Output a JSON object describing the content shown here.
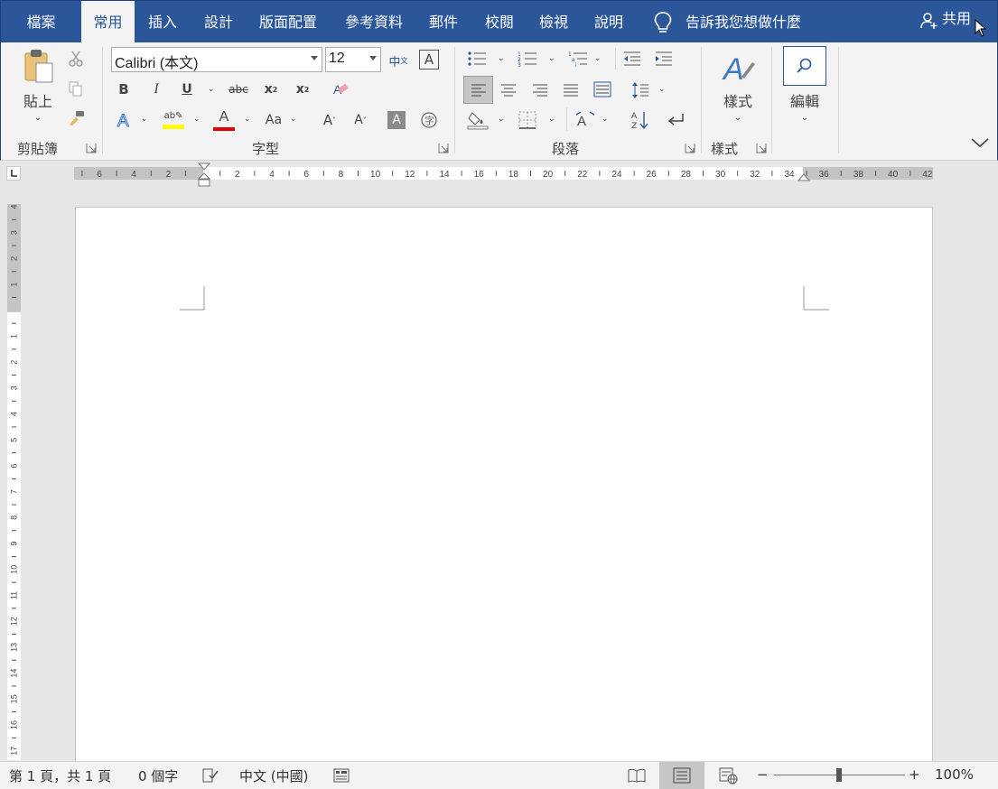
{
  "tabs": [
    {
      "label": "檔案"
    },
    {
      "label": "常用",
      "active": true
    },
    {
      "label": "插入"
    },
    {
      "label": "設計"
    },
    {
      "label": "版面配置"
    },
    {
      "label": "參考資料"
    },
    {
      "label": "郵件"
    },
    {
      "label": "校閱"
    },
    {
      "label": "檢視"
    },
    {
      "label": "說明"
    }
  ],
  "tell_me": "告訴我您想做什麼",
  "share_label": "共用",
  "ribbon": {
    "clipboard": {
      "paste_label": "貼上",
      "group_label": "剪貼簿"
    },
    "font": {
      "font_name": "Calibri (本文)",
      "font_size": "12",
      "group_label": "字型",
      "bold": "B",
      "italic": "I",
      "underline": "U",
      "strike": "abc",
      "change_case": "Aa",
      "highlight_color": "#ffff00",
      "font_color": "#e00000"
    },
    "paragraph": {
      "group_label": "段落"
    },
    "styles": {
      "label": "樣式",
      "group_label": "樣式"
    },
    "editing": {
      "label": "編輯"
    }
  },
  "ruler": {
    "horizontal_labels": [
      "6",
      "4",
      "2",
      "",
      "2",
      "4",
      "6",
      "8",
      "10",
      "12",
      "14",
      "16",
      "18",
      "20",
      "22",
      "24",
      "26",
      "28",
      "30",
      "32",
      "34",
      "36",
      "38",
      "40",
      "42"
    ],
    "vertical_labels": [
      "4",
      "3",
      "2",
      "1",
      "",
      "1",
      "2",
      "3",
      "4",
      "5",
      "6",
      "7",
      "8",
      "9",
      "10",
      "11",
      "12",
      "13",
      "14",
      "15",
      "16",
      "17"
    ]
  },
  "status": {
    "page_info": "第 1 頁，共 1 頁",
    "word_count": "0 個字",
    "language": "中文 (中國)",
    "zoom": "100%",
    "zoom_minus": "−",
    "zoom_plus": "+"
  },
  "colors": {
    "accent": "#2b579a",
    "ribbon_bg": "#f3f3f3",
    "canvas_bg": "#e6e6e6"
  }
}
